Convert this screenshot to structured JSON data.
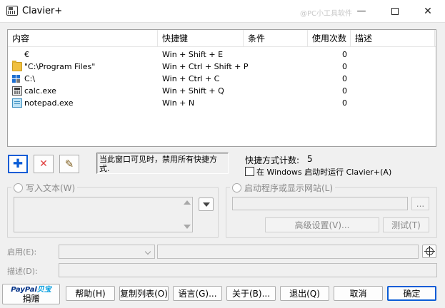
{
  "window": {
    "title": "Clavier+",
    "watermark": "@PC小工具软件",
    "minimize_glyph": "—",
    "maximize_glyph": "☐",
    "close_glyph": "✕"
  },
  "list": {
    "columns": [
      "内容",
      "快捷键",
      "条件",
      "使用次数",
      "描述"
    ],
    "rows": [
      {
        "icon": "euro-text",
        "content": "€",
        "shortcut": "Win + Shift + E",
        "condition": "",
        "count": "0",
        "description": ""
      },
      {
        "icon": "folder-icon",
        "content": "\"C:\\Program Files\"",
        "shortcut": "Win + Ctrl + Shift + P",
        "condition": "",
        "count": "0",
        "description": ""
      },
      {
        "icon": "drive-icon",
        "content": "C:\\",
        "shortcut": "Win + Ctrl + C",
        "condition": "",
        "count": "0",
        "description": ""
      },
      {
        "icon": "calculator-icon",
        "content": "calc.exe",
        "shortcut": "Win + Shift + Q",
        "condition": "",
        "count": "0",
        "description": ""
      },
      {
        "icon": "notepad-icon",
        "content": "notepad.exe",
        "shortcut": "Win + N",
        "condition": "",
        "count": "0",
        "description": ""
      }
    ]
  },
  "toolbar": {
    "add_glyph": "✚",
    "delete_glyph": "✕",
    "edit_glyph": "✎"
  },
  "note": "当此窗口可见时，禁用所有快捷方式.",
  "stats": {
    "count_label": "快捷方式计数:",
    "count_value": "5",
    "startup_label": "在 Windows 启动时运行 Clavier+(A)",
    "startup_checked": false
  },
  "write_text": {
    "label": "写入文本(W)",
    "selected": false,
    "value": ""
  },
  "launch": {
    "label": "启动程序或显示网站(L)",
    "selected": false,
    "value": "",
    "browse_label": "...",
    "advanced_label": "高级设置(V)...",
    "test_label": "测试(T)"
  },
  "enable": {
    "label": "启用(E):",
    "select_value": "",
    "text_value": ""
  },
  "description": {
    "label": "描述(D):",
    "value": ""
  },
  "paypal": {
    "brand": "PayPal",
    "brand_cn": "贝宝",
    "donate_label": "捐赠"
  },
  "buttons": {
    "help": "帮助(H)",
    "copy_list": "复制列表(O)",
    "language": "语言(G)...",
    "about": "关于(B)...",
    "exit": "退出(Q)",
    "cancel": "取消",
    "ok": "确定"
  },
  "colors": {
    "accent": "#0a5cd6",
    "delete_red": "#e04040",
    "paypal_dark": "#003087",
    "paypal_light": "#009cde"
  }
}
